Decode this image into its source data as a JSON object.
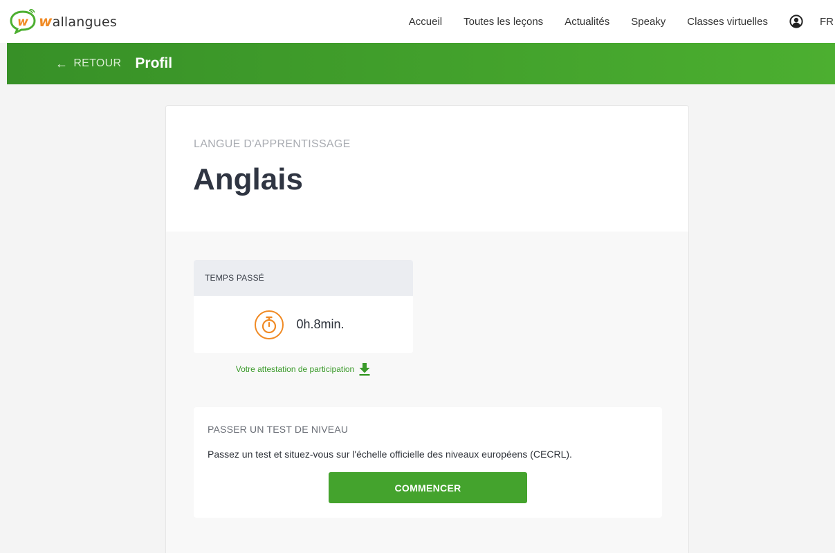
{
  "brand": {
    "logo_w": "w",
    "name_initial": "w",
    "name_rest": "allangues",
    "accent": "#f08a24",
    "green": "#44a32d"
  },
  "nav": {
    "items": [
      {
        "label": "Accueil"
      },
      {
        "label": "Toutes les leçons"
      },
      {
        "label": "Actualités"
      },
      {
        "label": "Speaky"
      },
      {
        "label": "Classes virtuelles"
      }
    ],
    "user_icon": "user-circle-icon",
    "language": "FR"
  },
  "header": {
    "back_label": "RETOUR",
    "back_icon": "arrow-left-icon",
    "title": "Profil"
  },
  "profile": {
    "language_label": "LANGUE D'APPRENTISSAGE",
    "language_name": "Anglais"
  },
  "time_spent": {
    "title": "TEMPS PASSÉ",
    "icon": "stopwatch-icon",
    "value": "0h.8min."
  },
  "certificate": {
    "label": "Votre attestation de participation",
    "icon": "download-icon"
  },
  "level_test": {
    "title": "PASSER UN TEST DE NIVEAU",
    "description": "Passez un test et situez-vous sur l'échelle officielle des niveaux européens (CECRL).",
    "button_label": "COMMENCER"
  }
}
